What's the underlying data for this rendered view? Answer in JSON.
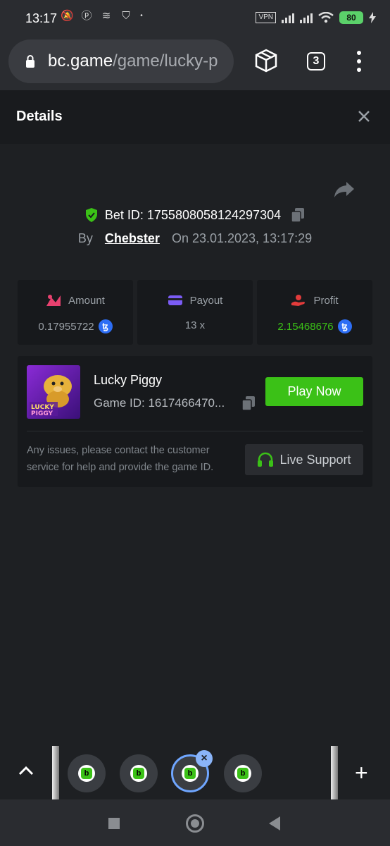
{
  "status_bar": {
    "time": "13:17",
    "vpn": "VPN",
    "battery": "80"
  },
  "browser": {
    "url_host": "bc.game",
    "url_path": "/game/lucky-p",
    "tab_count": "3"
  },
  "details": {
    "title": "Details"
  },
  "bet": {
    "id_label": "Bet ID: 1755808058124297304",
    "by_label": "By",
    "user": "Chebster",
    "on_label": "On",
    "datetime": "23.01.2023, 13:17:29"
  },
  "stats": {
    "amount": {
      "label": "Amount",
      "value": "0.17955722",
      "color": "#e8416f"
    },
    "payout": {
      "label": "Payout",
      "value": "13 x",
      "color": "#7b5cf5"
    },
    "profit": {
      "label": "Profit",
      "value": "2.15468676",
      "color": "#e23b3b",
      "value_color": "#3bc117"
    },
    "coin_symbol": "ꜩ"
  },
  "game": {
    "name": "Lucky Piggy",
    "id_label": "Game ID: 1617466470...",
    "play_label": "Play Now",
    "issue_text": "Any issues, please contact the customer service for help and provide the game ID.",
    "support_label": "Live Support"
  },
  "tab_strip": {
    "tab_close": "×",
    "plus": "+",
    "fav_letter": "b"
  },
  "colors": {
    "accent_green": "#3bc117",
    "bg": "#1e2023",
    "panel": "#17191c"
  }
}
